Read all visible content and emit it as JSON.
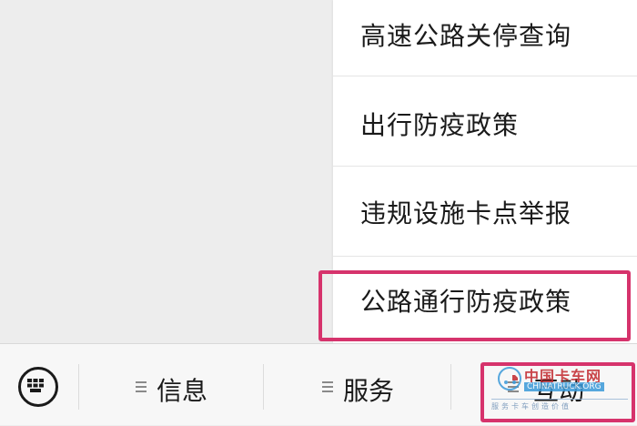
{
  "menu": {
    "items": [
      {
        "label": "高速公路关停查询"
      },
      {
        "label": "出行防疫政策"
      },
      {
        "label": "违规设施卡点举报"
      },
      {
        "label": "公路通行防疫政策"
      }
    ]
  },
  "bottom_bar": {
    "keyboard_icon": "keyboard-icon",
    "tabs": [
      {
        "label": "信息",
        "icon": "menu-lines-icon"
      },
      {
        "label": "服务",
        "icon": "menu-lines-icon"
      },
      {
        "label": "互动",
        "icon": "menu-lines-icon"
      }
    ]
  },
  "watermark": {
    "title": "中国卡车网",
    "url": "CHINATRUCK.ORG",
    "slogan": "服务卡车创造价值"
  },
  "colors": {
    "highlight": "#d6336c",
    "background": "#ededed",
    "menu_background": "#ffffff",
    "watermark_red": "#c2272d",
    "watermark_blue": "#3a9ad9"
  }
}
